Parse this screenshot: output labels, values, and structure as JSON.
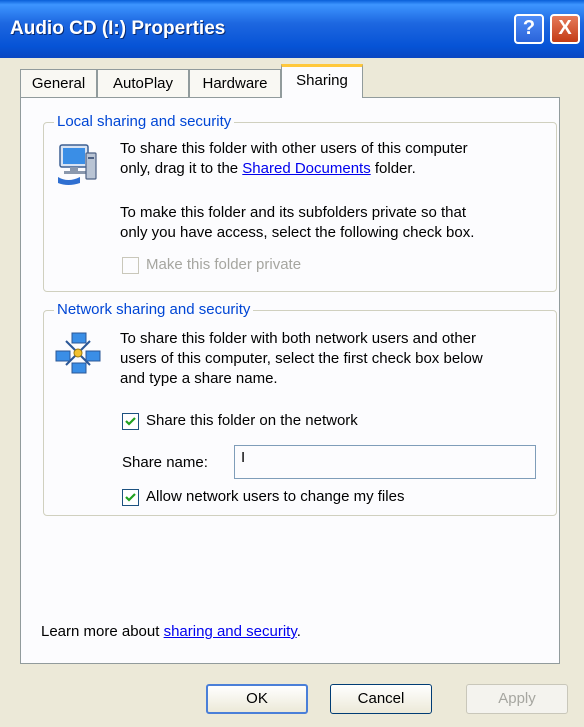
{
  "window": {
    "title": "Audio CD (I:) Properties",
    "help_label": "?",
    "close_label": "X"
  },
  "tabs": [
    {
      "label": "General"
    },
    {
      "label": "AutoPlay"
    },
    {
      "label": "Hardware"
    },
    {
      "label": "Sharing",
      "active": true
    }
  ],
  "local": {
    "legend": "Local sharing and security",
    "text1_a": "To share this folder with other users of this computer",
    "text1_b": "only, drag it to the",
    "link": "Shared Documents",
    "text1_c": "folder.",
    "text2_a": "To make this folder and its subfolders private so that",
    "text2_b": "only you have access, select the following check box.",
    "private_label": "Make this folder private",
    "private_checked": false,
    "private_enabled": false
  },
  "network": {
    "legend": "Network sharing and security",
    "text_a": "To share this folder with both network users and other",
    "text_b": "users of this computer, select the first check box below",
    "text_c": "and type a share name.",
    "share_label": "Share this folder on the network",
    "share_checked": true,
    "share_name_label": "Share name:",
    "share_name_value": "I",
    "allow_label": "Allow network users to change my files",
    "allow_checked": true
  },
  "footer": {
    "learn_text": "Learn more about",
    "learn_link": "sharing and security",
    "learn_end": "."
  },
  "buttons": {
    "ok": "OK",
    "cancel": "Cancel",
    "apply": "Apply"
  },
  "icons": {
    "local": "shared-computer-icon",
    "network": "network-computers-icon",
    "check": "checkmark-icon"
  }
}
